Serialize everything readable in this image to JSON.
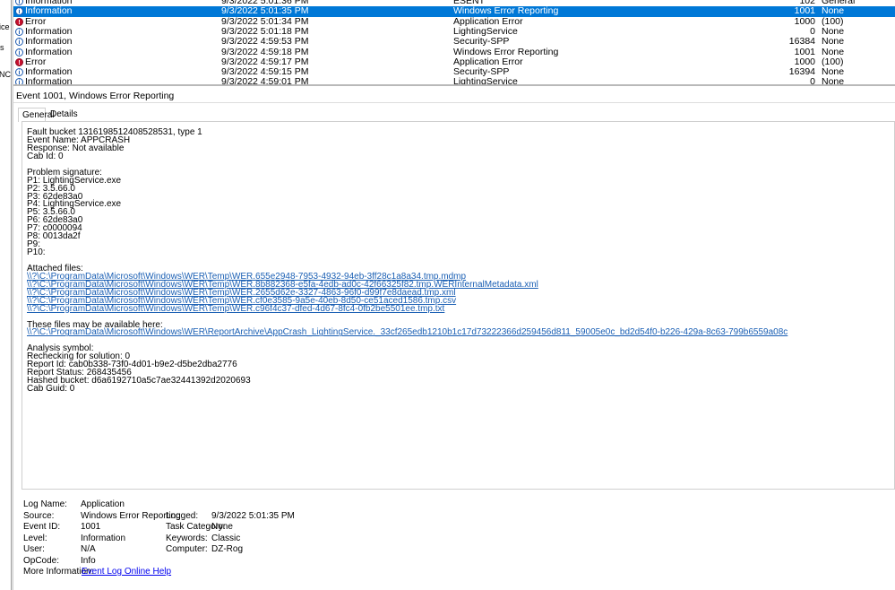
{
  "left_pane": {
    "fragments": [
      "ice",
      "s",
      "NC"
    ]
  },
  "event_list": {
    "rows": [
      {
        "level": "Information",
        "date": "9/3/2022 5:01:36 PM",
        "source": "ESENT",
        "event_id": "102",
        "category": "General",
        "type": "info",
        "selected": false
      },
      {
        "level": "Information",
        "date": "9/3/2022 5:01:35 PM",
        "source": "Windows Error Reporting",
        "event_id": "1001",
        "category": "None",
        "type": "info",
        "selected": true
      },
      {
        "level": "Error",
        "date": "9/3/2022 5:01:34 PM",
        "source": "Application Error",
        "event_id": "1000",
        "category": "(100)",
        "type": "error",
        "selected": false
      },
      {
        "level": "Information",
        "date": "9/3/2022 5:01:18 PM",
        "source": "LightingService",
        "event_id": "0",
        "category": "None",
        "type": "info",
        "selected": false
      },
      {
        "level": "Information",
        "date": "9/3/2022 4:59:53 PM",
        "source": "Security-SPP",
        "event_id": "16384",
        "category": "None",
        "type": "info",
        "selected": false
      },
      {
        "level": "Information",
        "date": "9/3/2022 4:59:18 PM",
        "source": "Windows Error Reporting",
        "event_id": "1001",
        "category": "None",
        "type": "info",
        "selected": false
      },
      {
        "level": "Error",
        "date": "9/3/2022 4:59:17 PM",
        "source": "Application Error",
        "event_id": "1000",
        "category": "(100)",
        "type": "error",
        "selected": false
      },
      {
        "level": "Information",
        "date": "9/3/2022 4:59:15 PM",
        "source": "Security-SPP",
        "event_id": "16394",
        "category": "None",
        "type": "info",
        "selected": false
      },
      {
        "level": "Information",
        "date": "9/3/2022 4:59:01 PM",
        "source": "LightingService",
        "event_id": "0",
        "category": "None",
        "type": "info",
        "selected": false
      }
    ]
  },
  "detail": {
    "title": "Event 1001, Windows Error Reporting",
    "tabs": [
      "General",
      "Details"
    ],
    "description_lines": [
      {
        "text": "Fault bucket 1316198512408528531, type 1",
        "link": false
      },
      {
        "text": "Event Name: APPCRASH",
        "link": false
      },
      {
        "text": "Response: Not available",
        "link": false
      },
      {
        "text": "Cab Id: 0",
        "link": false
      },
      {
        "text": "",
        "link": false
      },
      {
        "text": "Problem signature:",
        "link": false
      },
      {
        "text": "P1: LightingService.exe",
        "link": false
      },
      {
        "text": "P2: 3.5.66.0",
        "link": false
      },
      {
        "text": "P3: 62de83a0",
        "link": false
      },
      {
        "text": "P4: LightingService.exe",
        "link": false
      },
      {
        "text": "P5: 3.5.66.0",
        "link": false
      },
      {
        "text": "P6: 62de83a0",
        "link": false
      },
      {
        "text": "P7: c0000094",
        "link": false
      },
      {
        "text": "P8: 0013da2f",
        "link": false
      },
      {
        "text": "P9:",
        "link": false
      },
      {
        "text": "P10:",
        "link": false
      },
      {
        "text": "",
        "link": false
      },
      {
        "text": "Attached files:",
        "link": false
      },
      {
        "text": "\\\\?\\C:\\ProgramData\\Microsoft\\Windows\\WER\\Temp\\WER.655e2948-7953-4932-94eb-3ff28c1a8a34.tmp.mdmp",
        "link": true
      },
      {
        "text": "\\\\?\\C:\\ProgramData\\Microsoft\\Windows\\WER\\Temp\\WER.8b882368-e5fa-4edb-ad0c-42f66325f82.tmp.WERInternalMetadata.xml",
        "link": true
      },
      {
        "text": "\\\\?\\C:\\ProgramData\\Microsoft\\Windows\\WER\\Temp\\WER.2655d62e-3327-4863-96f0-d99f7e8daead.tmp.xml",
        "link": true
      },
      {
        "text": "\\\\?\\C:\\ProgramData\\Microsoft\\Windows\\WER\\Temp\\WER.cf0e3585-9a5e-40eb-8d50-ce51aced1586.tmp.csv",
        "link": true
      },
      {
        "text": "\\\\?\\C:\\ProgramData\\Microsoft\\Windows\\WER\\Temp\\WER.c96f4c37-dfed-4d67-8fc4-0fb2be5501ee.tmp.txt",
        "link": true
      },
      {
        "text": "",
        "link": false
      },
      {
        "text": "These files may be available here:",
        "link": false
      },
      {
        "text": "\\\\?\\C:\\ProgramData\\Microsoft\\Windows\\WER\\ReportArchive\\AppCrash_LightingService._33cf265edb1210b1c17d73222366d259456d811_59005e0c_bd2d54f0-b226-429a-8c63-799b6559a08c",
        "link": true
      },
      {
        "text": "",
        "link": false
      },
      {
        "text": "Analysis symbol:",
        "link": false
      },
      {
        "text": "Rechecking for solution: 0",
        "link": false
      },
      {
        "text": "Report Id: cab0b338-73f0-4d01-b9e2-d5be2dba2776",
        "link": false
      },
      {
        "text": "Report Status: 268435456",
        "link": false
      },
      {
        "text": "Hashed bucket: d6a6192710a5c7ae32441392d2020693",
        "link": false
      },
      {
        "text": "Cab Guid: 0",
        "link": false
      }
    ],
    "properties": {
      "log_name_label": "Log Name:",
      "log_name": "Application",
      "source_label": "Source:",
      "source": "Windows Error Reporting",
      "logged_label": "Logged:",
      "logged": "9/3/2022 5:01:35 PM",
      "event_id_label": "Event ID:",
      "event_id": "1001",
      "task_category_label": "Task Category:",
      "task_category": "None",
      "level_label": "Level:",
      "level": "Information",
      "keywords_label": "Keywords:",
      "keywords": "Classic",
      "user_label": "User:",
      "user": "N/A",
      "computer_label": "Computer:",
      "computer": "DZ-Rog",
      "opcode_label": "OpCode:",
      "opcode": "Info",
      "more_info_label": "More Information:",
      "more_info_link": "Event Log Online Help"
    }
  },
  "colors": {
    "selection": "#0078d7",
    "error_icon": "#c8102e",
    "info_icon": "#1c5ab0",
    "link": "#1a5fb4"
  }
}
